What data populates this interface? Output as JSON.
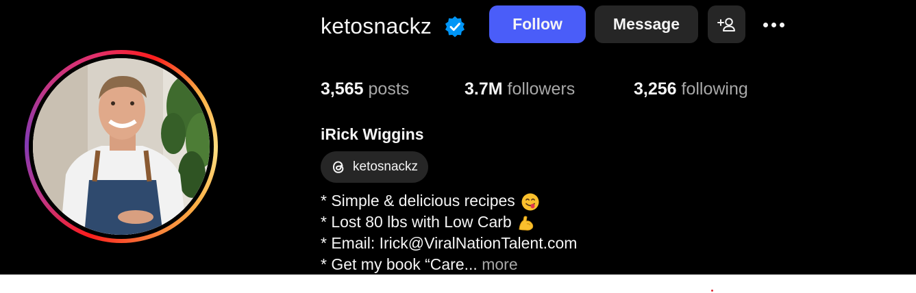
{
  "profile": {
    "username": "ketosnackz",
    "verified": true,
    "full_name": "iRick Wiggins",
    "threads_handle": "ketosnackz"
  },
  "actions": {
    "follow_label": "Follow",
    "message_label": "Message",
    "suggest_icon": "person-add-icon",
    "more_icon": "more-horizontal-icon"
  },
  "stats": {
    "posts_count": "3,565",
    "posts_label": "posts",
    "followers_count": "3.7M",
    "followers_label": "followers",
    "following_count": "3,256",
    "following_label": "following"
  },
  "bio": {
    "line1": "* Simple & delicious recipes",
    "line1_emoji": "face-savoring-food-emoji",
    "line2": "* Lost 80 lbs with Low Carb",
    "line2_emoji": "flexed-biceps-emoji",
    "line3": "* Email: Irick@ViralNationTalent.com",
    "line4": "* Get my book “Care...",
    "more_label": "more"
  },
  "colors": {
    "background": "#000000",
    "follow_button": "#4a5df9",
    "secondary_button": "#262626",
    "verified_badge": "#0095f6",
    "muted_text": "#a8a8a8"
  }
}
